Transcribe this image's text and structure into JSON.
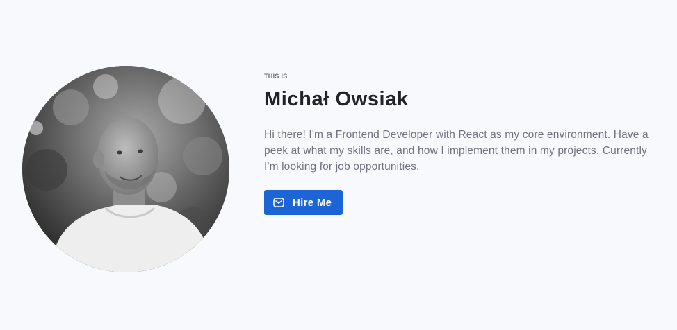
{
  "hero": {
    "eyebrow": "THIS IS",
    "name": "Michał Owsiak",
    "bio": "Hi there! I'm a Frontend Developer with React as my core environment. Have a peek at what my skills are, and how I implement them in my projects. Currently I'm looking for job opportunities.",
    "cta": {
      "label": "Hire Me",
      "icon": "envelope-icon"
    }
  },
  "colors": {
    "background": "#f8f9fd",
    "accent": "#1d64d6",
    "heading": "#222328",
    "body_text": "#6f7280"
  }
}
